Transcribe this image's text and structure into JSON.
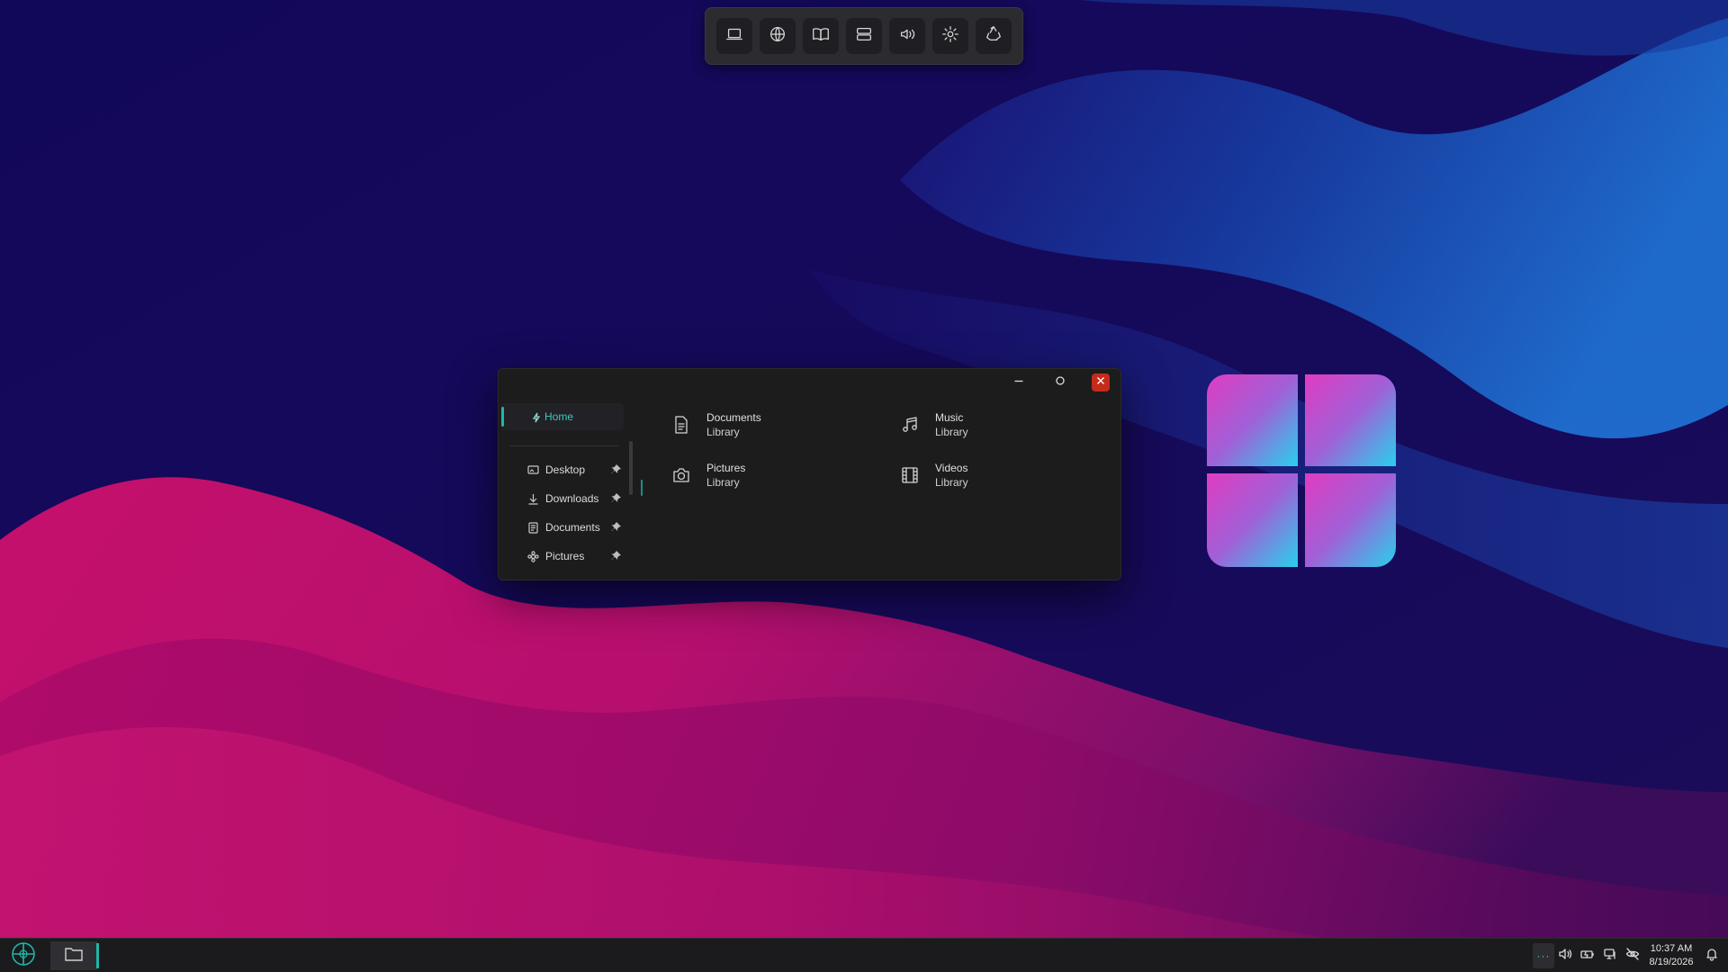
{
  "dock": {
    "items": [
      {
        "icon": "laptop-icon"
      },
      {
        "icon": "globe-icon"
      },
      {
        "icon": "book-icon"
      },
      {
        "icon": "server-icon"
      },
      {
        "icon": "volume-icon"
      },
      {
        "icon": "gear-icon"
      },
      {
        "icon": "recycle-bin-icon"
      }
    ]
  },
  "explorer": {
    "sidebar": {
      "home_label": "Home",
      "items": [
        {
          "label": "Desktop",
          "icon": "desktop-icon",
          "pinned": true
        },
        {
          "label": "Downloads",
          "icon": "download-icon",
          "pinned": true
        },
        {
          "label": "Documents",
          "icon": "document-icon",
          "pinned": true
        },
        {
          "label": "Pictures",
          "icon": "pictures-icon",
          "pinned": true
        }
      ]
    },
    "libraries": [
      {
        "name": "Documents",
        "sub": "Library",
        "icon": "document-icon"
      },
      {
        "name": "Music",
        "sub": "Library",
        "icon": "music-icon"
      },
      {
        "name": "Pictures",
        "sub": "Library",
        "icon": "camera-icon"
      },
      {
        "name": "Videos",
        "sub": "Library",
        "icon": "film-icon"
      }
    ]
  },
  "taskbar": {
    "tray_more": "···",
    "clock": {
      "time": "10:37 AM",
      "date": "8/19/2026"
    }
  },
  "colors": {
    "accent": "#1fb6a8",
    "close": "#c42b1c",
    "wallpaper_blue": "#140a52",
    "wallpaper_pink": "#c8106e"
  }
}
